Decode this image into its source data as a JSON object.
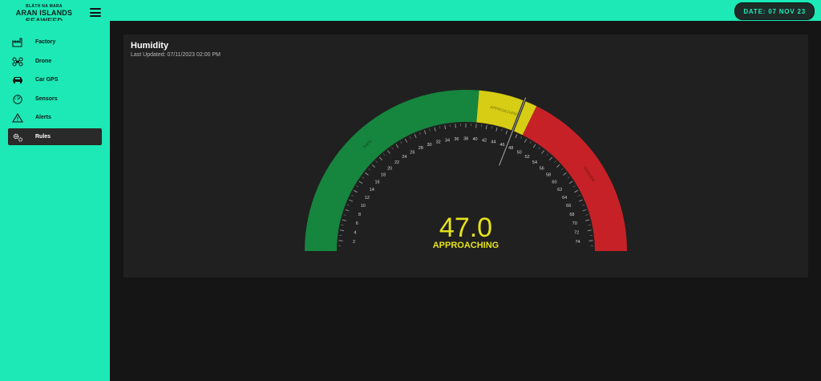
{
  "brand": {
    "subtitle": "BLÁTH NA MARA",
    "line1": "ARAN ISLANDS",
    "line2": "SEAWEED"
  },
  "header": {
    "date": "DATE: 07 NOV 23"
  },
  "sidebar": {
    "items": [
      {
        "label": "Factory",
        "icon": "factory-icon"
      },
      {
        "label": "Drone",
        "icon": "drone-icon"
      },
      {
        "label": "Car GPS",
        "icon": "car-icon"
      },
      {
        "label": "Sensors",
        "icon": "gauge-icon"
      },
      {
        "label": "Alerts",
        "icon": "warning-icon"
      },
      {
        "label": "Rules",
        "icon": "gears-icon",
        "active": true
      }
    ]
  },
  "panel": {
    "title": "Humidity",
    "last_updated": "Last Updated: 07/11/2023 02:00 PM"
  },
  "gauge": {
    "value": 47.0,
    "value_text": "47.0",
    "status": "APPROACHING",
    "min": 0,
    "max": 76,
    "ticks": [
      "2",
      "4",
      "6",
      "8",
      "10",
      "12",
      "14",
      "16",
      "18",
      "20",
      "22",
      "24",
      "26",
      "28",
      "30",
      "32",
      "34",
      "36",
      "38",
      "40",
      "42",
      "44",
      "46",
      "48",
      "50",
      "52",
      "54",
      "56",
      "58",
      "60",
      "62",
      "64",
      "66",
      "68",
      "70",
      "72",
      "74"
    ],
    "zones": [
      {
        "label": "SAFE",
        "from": 0,
        "to": 40,
        "color": "#16853e"
      },
      {
        "label": "APPROACHING",
        "from": 40,
        "to": 49,
        "color": "#d6cd14"
      },
      {
        "label": "DANGER",
        "from": 49,
        "to": 76,
        "color": "#c62127"
      }
    ],
    "value_color": "#e6e31a"
  },
  "colors": {
    "accent": "#1de9b6",
    "background": "#151515",
    "panel": "#202020"
  }
}
